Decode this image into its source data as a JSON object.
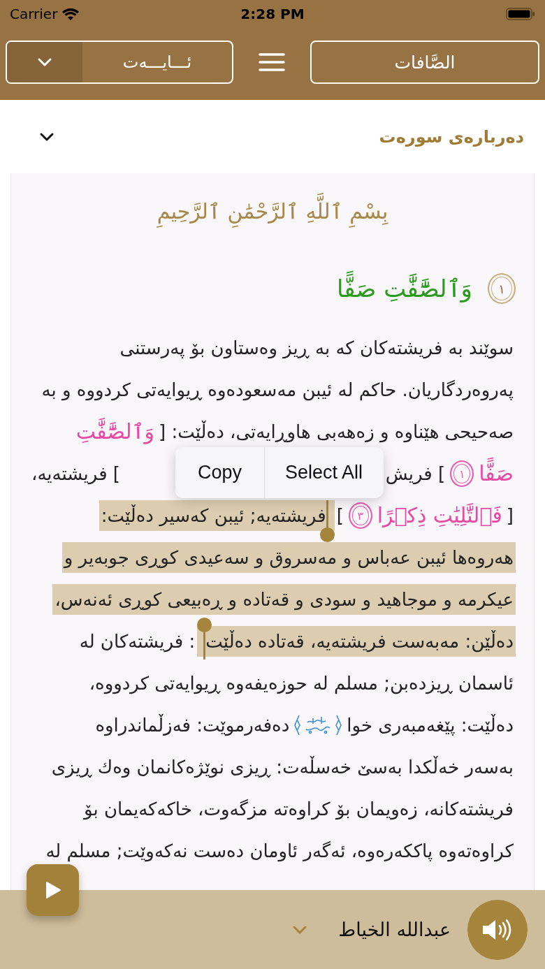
{
  "status_bar": {
    "carrier": "Carrier",
    "time": "2:28 PM"
  },
  "nav": {
    "ayah_picker": "ئـــايـــەت",
    "surah": "الصَّافات"
  },
  "about": {
    "title": "دەربارەی سورەت"
  },
  "bismillah": "بِسْمِ ٱللَّهِ ٱلرَّحْمَٰنِ ٱلرَّحِيمِ",
  "ayah": {
    "text": "وَٱلصَّٰٓفَّٰتِ صَفًّا",
    "number": "١"
  },
  "tafsir_lines": [
    {
      "covered": false,
      "segments": [
        {
          "kind": "text",
          "text": "سوێند بە فریشتەکان کە بە ڕیز وەستاون بۆ پەرستنی",
          "selected": false
        }
      ]
    },
    {
      "covered": false,
      "segments": [
        {
          "kind": "text",
          "text": "پەروەردگاریان. حاکم لە ئیبن مەسعودەوە ڕیوایەتی کردووە و بە",
          "selected": false
        }
      ]
    },
    {
      "covered": false,
      "segments": [
        {
          "kind": "text",
          "text": "صەحیحی هێناوە و زەهەبی هاوڕایەتی، دەڵێت: [",
          "selected": false
        },
        {
          "kind": "quran",
          "text": "وَٱلصَّٰٓفَّٰتِ",
          "selected": false
        }
      ]
    },
    {
      "covered": true,
      "segments": [
        {
          "kind": "quran",
          "text": "صَفًّا",
          "selected": false
        },
        {
          "kind": "mark",
          "text": "١",
          "selected": false
        },
        {
          "kind": "text",
          "text": "] فریش",
          "selected": false
        },
        {
          "kind": "text",
          "text": "] فریشتەیە،",
          "selected": false
        }
      ]
    },
    {
      "covered": false,
      "segments": [
        {
          "kind": "text",
          "text": "[",
          "selected": false
        },
        {
          "kind": "quran",
          "text": "فَٱلتَّٰلِيَٰتِ ذِكۡرًا",
          "selected": false
        },
        {
          "kind": "mark",
          "text": "٣",
          "selected": false
        },
        {
          "kind": "text",
          "text": "]",
          "selected": false
        },
        {
          "kind": "text",
          "text": "فریشتەیە; ئیبن کەسیر دەڵێت:",
          "selected": true
        }
      ]
    },
    {
      "covered": false,
      "segments": [
        {
          "kind": "text",
          "text": "هەروەها ئیبن عەباس و مەسروق و سەعیدی کوڕی جوبەیر و",
          "selected": true
        }
      ]
    },
    {
      "covered": false,
      "segments": [
        {
          "kind": "text",
          "text": "عیکرمە و موجاهید و سودی و قەتادە و ڕەبیعی کوڕی ئەنەس،",
          "selected": true
        }
      ]
    },
    {
      "covered": false,
      "segments": [
        {
          "kind": "text",
          "text": "دەڵێن: مەبەست فریشتەیە، قەتادە دەڵێت",
          "selected": true
        },
        {
          "kind": "text",
          "text": ": فریشتەکان لە",
          "selected": false
        }
      ]
    },
    {
      "covered": false,
      "segments": [
        {
          "kind": "text",
          "text": "ئاسمان ڕیزدەبن; مسلم لە حوزەیفەوە ڕیوایەتی کردووە،",
          "selected": false
        }
      ]
    },
    {
      "covered": false,
      "segments": [
        {
          "kind": "text",
          "text": "دەڵێت: پێغەمبەری خوا",
          "selected": false
        },
        {
          "kind": "honorific",
          "selected": false
        },
        {
          "kind": "text",
          "text": "دەفەرموێت: فەزڵماندراوە",
          "selected": false
        }
      ]
    },
    {
      "covered": false,
      "segments": [
        {
          "kind": "text",
          "text": "بەسەر خەڵکدا بەسێ خەسڵەت: ڕیزی نوێژەکانمان وەك ڕیزی",
          "selected": false
        }
      ]
    },
    {
      "covered": false,
      "segments": [
        {
          "kind": "text",
          "text": "فریشتەکانە، زەویمان بۆ کراوەتە مزگەوت، خاکەکەیمان بۆ",
          "selected": false
        }
      ]
    },
    {
      "covered": false,
      "segments": [
        {
          "kind": "text",
          "text": "کراوەتەوە پاککەرەوە، ئەگەر ئاومان دەست نەکەوێت; مسلم لە",
          "selected": false
        }
      ]
    }
  ],
  "context_menu": [
    "Select All",
    "Copy"
  ],
  "player": {
    "reciter": "عبدالله الخیاط"
  }
}
